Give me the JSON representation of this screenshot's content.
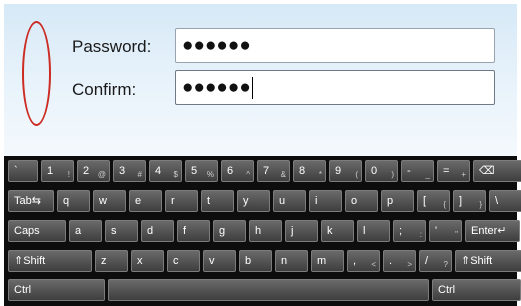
{
  "form": {
    "password_label": "Password:",
    "password_value": "●●●●●●",
    "confirm_label": "Confirm:",
    "confirm_value": "●●●●●●"
  },
  "keyboard": {
    "rows": [
      [
        {
          "label": "`",
          "sub": "",
          "w": 30
        },
        {
          "label": "1",
          "sub": "!",
          "w": 33
        },
        {
          "label": "2",
          "sub": "@",
          "w": 33
        },
        {
          "label": "3",
          "sub": "#",
          "w": 33
        },
        {
          "label": "4",
          "sub": "$",
          "w": 33
        },
        {
          "label": "5",
          "sub": "%",
          "w": 33
        },
        {
          "label": "6",
          "sub": "^",
          "w": 33
        },
        {
          "label": "7",
          "sub": "&",
          "w": 33
        },
        {
          "label": "8",
          "sub": "*",
          "w": 33
        },
        {
          "label": "9",
          "sub": "(",
          "w": 33
        },
        {
          "label": "0",
          "sub": ")",
          "w": 33
        },
        {
          "label": "-",
          "sub": "_",
          "w": 33
        },
        {
          "label": "=",
          "sub": "+",
          "w": 33
        },
        {
          "label": "⌫",
          "sub": "",
          "w": 64
        }
      ],
      [
        {
          "label": "Tab⇆",
          "sub": "",
          "w": 46
        },
        {
          "label": "q",
          "sub": "",
          "w": 33
        },
        {
          "label": "w",
          "sub": "",
          "w": 33
        },
        {
          "label": "e",
          "sub": "",
          "w": 33
        },
        {
          "label": "r",
          "sub": "",
          "w": 33
        },
        {
          "label": "t",
          "sub": "",
          "w": 33
        },
        {
          "label": "y",
          "sub": "",
          "w": 33
        },
        {
          "label": "u",
          "sub": "",
          "w": 33
        },
        {
          "label": "i",
          "sub": "",
          "w": 33
        },
        {
          "label": "o",
          "sub": "",
          "w": 33
        },
        {
          "label": "p",
          "sub": "",
          "w": 33
        },
        {
          "label": "[",
          "sub": "{",
          "w": 33
        },
        {
          "label": "]",
          "sub": "}",
          "w": 33
        },
        {
          "label": "\\",
          "sub": "|",
          "w": 48
        }
      ],
      [
        {
          "label": "Caps",
          "sub": "",
          "w": 58
        },
        {
          "label": "a",
          "sub": "",
          "w": 33
        },
        {
          "label": "s",
          "sub": "",
          "w": 33
        },
        {
          "label": "d",
          "sub": "",
          "w": 33
        },
        {
          "label": "f",
          "sub": "",
          "w": 33
        },
        {
          "label": "g",
          "sub": "",
          "w": 33
        },
        {
          "label": "h",
          "sub": "",
          "w": 33
        },
        {
          "label": "j",
          "sub": "",
          "w": 33
        },
        {
          "label": "k",
          "sub": "",
          "w": 33
        },
        {
          "label": "l",
          "sub": "",
          "w": 33
        },
        {
          "label": ";",
          "sub": ":",
          "w": 33
        },
        {
          "label": "'",
          "sub": "\"",
          "w": 33
        },
        {
          "label": "Enter↵",
          "sub": "",
          "w": 55
        }
      ],
      [
        {
          "label": "⇑Shift",
          "sub": "",
          "w": 84
        },
        {
          "label": "z",
          "sub": "",
          "w": 33
        },
        {
          "label": "x",
          "sub": "",
          "w": 33
        },
        {
          "label": "c",
          "sub": "",
          "w": 33
        },
        {
          "label": "v",
          "sub": "",
          "w": 33
        },
        {
          "label": "b",
          "sub": "",
          "w": 33
        },
        {
          "label": "n",
          "sub": "",
          "w": 33
        },
        {
          "label": "m",
          "sub": "",
          "w": 33
        },
        {
          "label": ",",
          "sub": "<",
          "w": 33
        },
        {
          "label": ".",
          "sub": ">",
          "w": 33
        },
        {
          "label": "/",
          "sub": "?",
          "w": 33
        },
        {
          "label": "⇑Shift",
          "sub": "",
          "w": 75
        }
      ],
      [
        {
          "label": "Ctrl",
          "sub": "",
          "w": 97
        },
        {
          "label": "",
          "sub": "",
          "w": 321
        },
        {
          "label": "Ctrl",
          "sub": "",
          "w": 89
        }
      ]
    ]
  }
}
